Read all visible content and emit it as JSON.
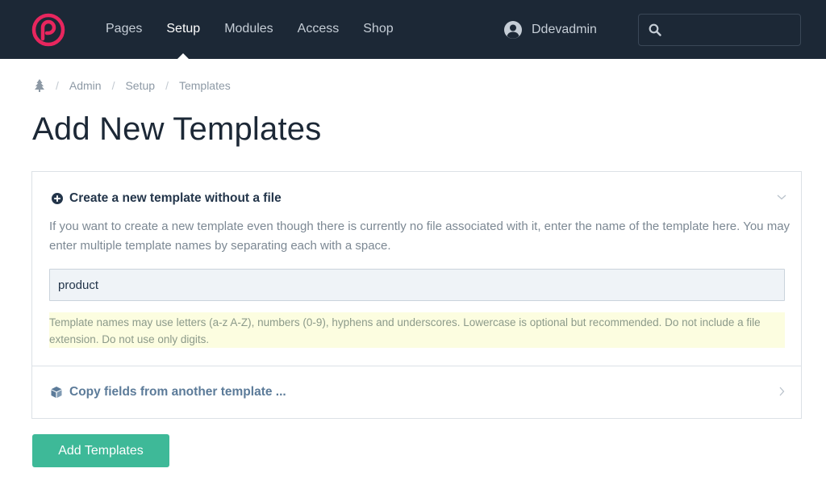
{
  "nav": {
    "items": [
      {
        "label": "Pages",
        "active": false
      },
      {
        "label": "Setup",
        "active": true
      },
      {
        "label": "Modules",
        "active": false
      },
      {
        "label": "Access",
        "active": false
      },
      {
        "label": "Shop",
        "active": false
      }
    ],
    "user": {
      "name": "Ddevadmin",
      "icon": "user-circle-icon"
    },
    "search": {
      "icon": "search-icon",
      "value": ""
    },
    "logo_color": "#e8265e"
  },
  "breadcrumb": {
    "home_icon": "tree-icon",
    "items": [
      "Admin",
      "Setup",
      "Templates"
    ]
  },
  "page": {
    "title": "Add New Templates"
  },
  "section_new": {
    "icon": "plus-circle-icon",
    "title": "Create a new template without a file",
    "description": "If you want to create a new template even though there is currently no file associated with it, enter the name of the template here. You may enter multiple template names by separating each with a space.",
    "input_value": "product",
    "notice": "Template names may use letters (a-z A-Z), numbers (0-9), hyphens and underscores. Lowercase is optional but recommended. Do not include a file extension. Do not use only digits.",
    "expanded": true
  },
  "section_copy": {
    "icon": "cube-icon",
    "title": "Copy fields from another template ...",
    "expanded": false
  },
  "submit": {
    "label": "Add Templates",
    "color": "#3eb998"
  },
  "colors": {
    "topbar": "#1c2836",
    "notice_bg": "#fcfde0"
  }
}
